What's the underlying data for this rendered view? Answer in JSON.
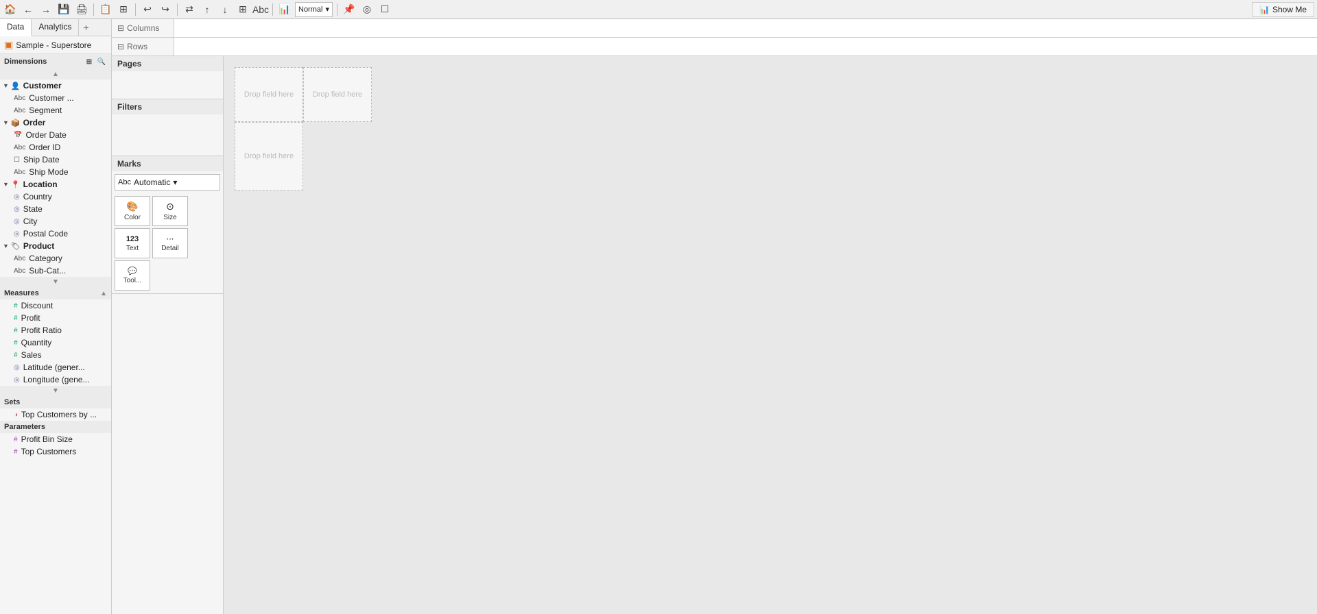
{
  "toolbar": {
    "normal_label": "Normal",
    "show_me_label": "Show Me",
    "show_me_icon": "📊"
  },
  "tabs": {
    "data_label": "Data",
    "analytics_label": "Analytics"
  },
  "datasource": {
    "label": "Sample - Superstore"
  },
  "sidebar": {
    "dimensions_label": "Dimensions",
    "measures_label": "Measures",
    "sets_label": "Sets",
    "parameters_label": "Parameters",
    "customer_group": "Customer",
    "order_group": "Order",
    "location_group": "Location",
    "product_group": "Product",
    "dimensions": {
      "customer": [
        {
          "label": "Customer ...",
          "type": "abc"
        },
        {
          "label": "Segment",
          "type": "abc"
        }
      ],
      "order": [
        {
          "label": "Order Date",
          "type": "date-cal"
        },
        {
          "label": "Order ID",
          "type": "abc"
        },
        {
          "label": "Ship Date",
          "type": "date"
        },
        {
          "label": "Ship Mode",
          "type": "abc"
        }
      ],
      "location": [
        {
          "label": "Country",
          "type": "geo"
        },
        {
          "label": "State",
          "type": "geo"
        },
        {
          "label": "City",
          "type": "geo"
        },
        {
          "label": "Postal Code",
          "type": "geo"
        }
      ],
      "product": [
        {
          "label": "Category",
          "type": "abc"
        },
        {
          "label": "Sub-Cat...",
          "type": "abc"
        }
      ]
    },
    "measures": [
      {
        "label": "Discount",
        "type": "measure"
      },
      {
        "label": "Profit",
        "type": "measure"
      },
      {
        "label": "Profit Ratio",
        "type": "measure"
      },
      {
        "label": "Quantity",
        "type": "measure"
      },
      {
        "label": "Sales",
        "type": "measure"
      },
      {
        "label": "Latitude (gener...",
        "type": "geo-measure"
      },
      {
        "label": "Longitude (gene...",
        "type": "geo-measure"
      }
    ],
    "sets": [
      {
        "label": "Top Customers by ...",
        "type": "set"
      }
    ],
    "parameters": [
      {
        "label": "Profit Bin Size",
        "type": "param"
      },
      {
        "label": "Top Customers",
        "type": "param"
      }
    ]
  },
  "shelves": {
    "pages_label": "Pages",
    "filters_label": "Filters",
    "columns_label": "Columns",
    "rows_label": "Rows"
  },
  "marks": {
    "label": "Marks",
    "dropdown_label": "Automatic",
    "buttons": [
      {
        "icon": "🎨",
        "label": "Color"
      },
      {
        "icon": "⊙",
        "label": "Size"
      },
      {
        "icon": "123",
        "label": "Text"
      },
      {
        "icon": "⋯",
        "label": "Detail"
      },
      {
        "icon": "💬",
        "label": "Tool..."
      }
    ]
  },
  "canvas": {
    "drop_field_here": "Drop field here"
  }
}
